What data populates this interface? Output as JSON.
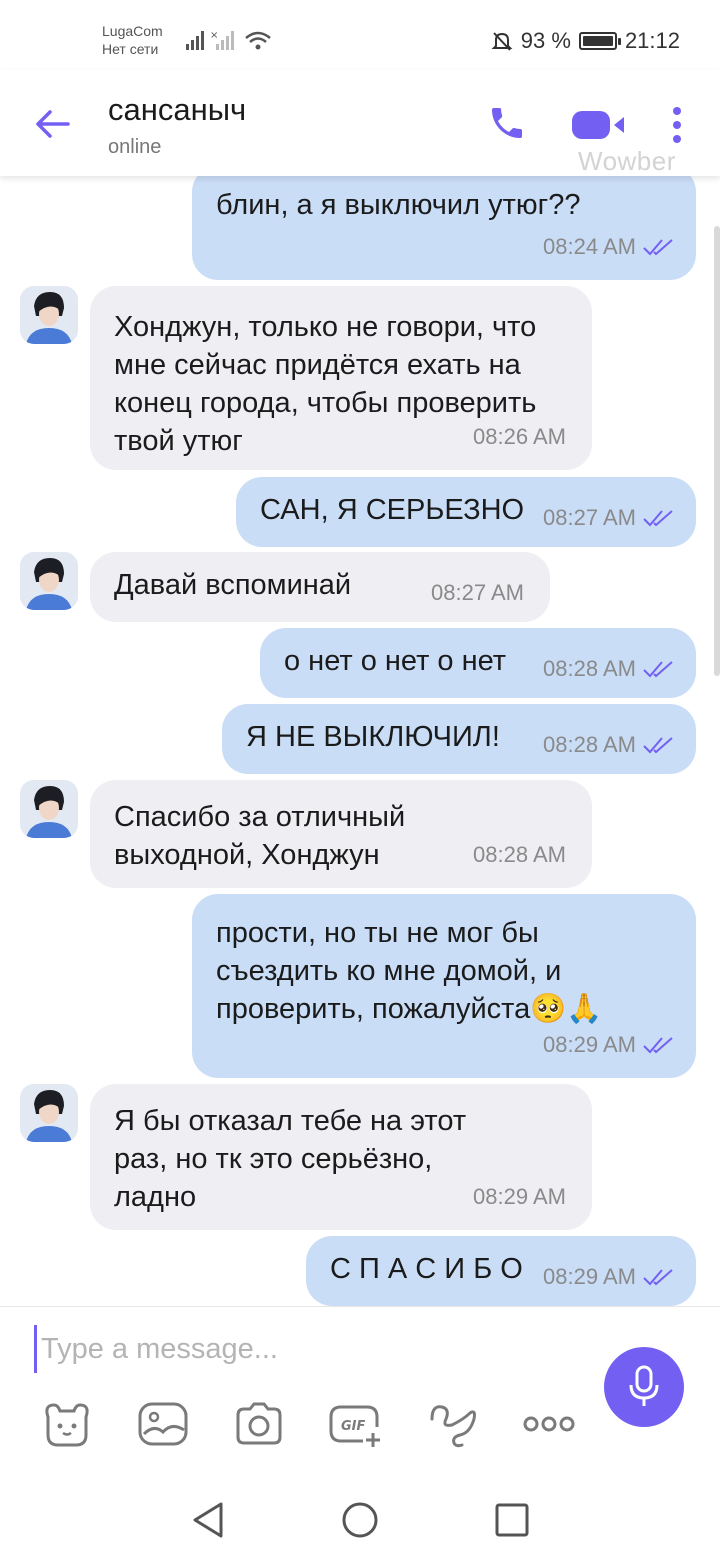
{
  "status_bar": {
    "carrier": "LugaCom",
    "network_status": "Нет сети",
    "battery": "93 %",
    "time": "21:12"
  },
  "header": {
    "contact_name": "сансаныч",
    "status": "online",
    "watermark": "Wowber"
  },
  "colors": {
    "accent": "#7360f2",
    "outgoing_bubble": "#c9ddf7",
    "incoming_bubble": "#efeef3"
  },
  "messages": [
    {
      "direction": "out",
      "text": "блин, а я выключил утюг??",
      "time": "08:24 AM",
      "read": true
    },
    {
      "direction": "in",
      "text": "Хонджун, только не говори, что мне сейчас придётся ехать на конец города, чтобы проверить твой утюг",
      "time": "08:26 AM"
    },
    {
      "direction": "out",
      "text": "САН, Я СЕРЬЕЗНО",
      "time": "08:27 AM",
      "read": true
    },
    {
      "direction": "in",
      "text": "Давай вспоминай",
      "time": "08:27 AM"
    },
    {
      "direction": "out",
      "text": "о нет о нет о нет",
      "time": "08:28 AM",
      "read": true
    },
    {
      "direction": "out",
      "text": "Я НЕ ВЫКЛЮЧИЛ!",
      "time": "08:28 AM",
      "read": true
    },
    {
      "direction": "in",
      "text": "Спасибо за отличный выходной, Хонджун",
      "time": "08:28 AM"
    },
    {
      "direction": "out",
      "text": "прости, но ты не мог бы съездить ко мне домой, и проверить, пожалуйста🥺🙏",
      "time": "08:29 AM",
      "read": true
    },
    {
      "direction": "in",
      "text": "Я бы отказал тебе на этот раз, но тк это серьёзно, ладно",
      "time": "08:29 AM"
    },
    {
      "direction": "out",
      "text": "С П А С И Б О",
      "time": "08:29 AM",
      "read": true
    }
  ],
  "composer": {
    "placeholder": "Type a message...",
    "tools": [
      "sticker-icon",
      "gallery-icon",
      "camera-icon",
      "gif-icon",
      "doodle-icon",
      "more-options-icon"
    ]
  }
}
